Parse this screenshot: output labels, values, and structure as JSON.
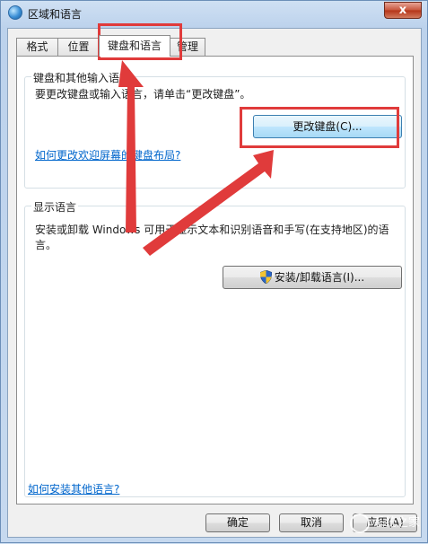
{
  "window": {
    "title": "区域和语言",
    "close_label": "x"
  },
  "tabs": [
    {
      "label": "格式"
    },
    {
      "label": "位置"
    },
    {
      "label": "键盘和语言"
    },
    {
      "label": "管理"
    }
  ],
  "keyboard_group": {
    "label": "键盘和其他输入语言",
    "description": "要更改键盘或输入语言，请单击“更改键盘”。",
    "change_keyboard_button": "更改键盘(C)...",
    "welcome_link": "如何更改欢迎屏幕的键盘布局?"
  },
  "display_group": {
    "label": "显示语言",
    "description_line1": "安装或卸载 Windows 可用于显示文本和识别语音和手写(在支持地区)的语",
    "description_line2": "言。",
    "install_button": "安装/卸载语言(I)..."
  },
  "footer": {
    "other_languages_link": "如何安装其他语言?",
    "ok_label": "确定",
    "cancel_label": "取消",
    "apply_label": "应用(A)"
  },
  "watermark": {
    "text": "系统之家"
  },
  "colors": {
    "annotation": "#e03b3b",
    "link": "#0066cc",
    "accent": "#3c7fb1"
  },
  "icons": {
    "window": "globe-icon",
    "install": "uac-shield-icon"
  }
}
